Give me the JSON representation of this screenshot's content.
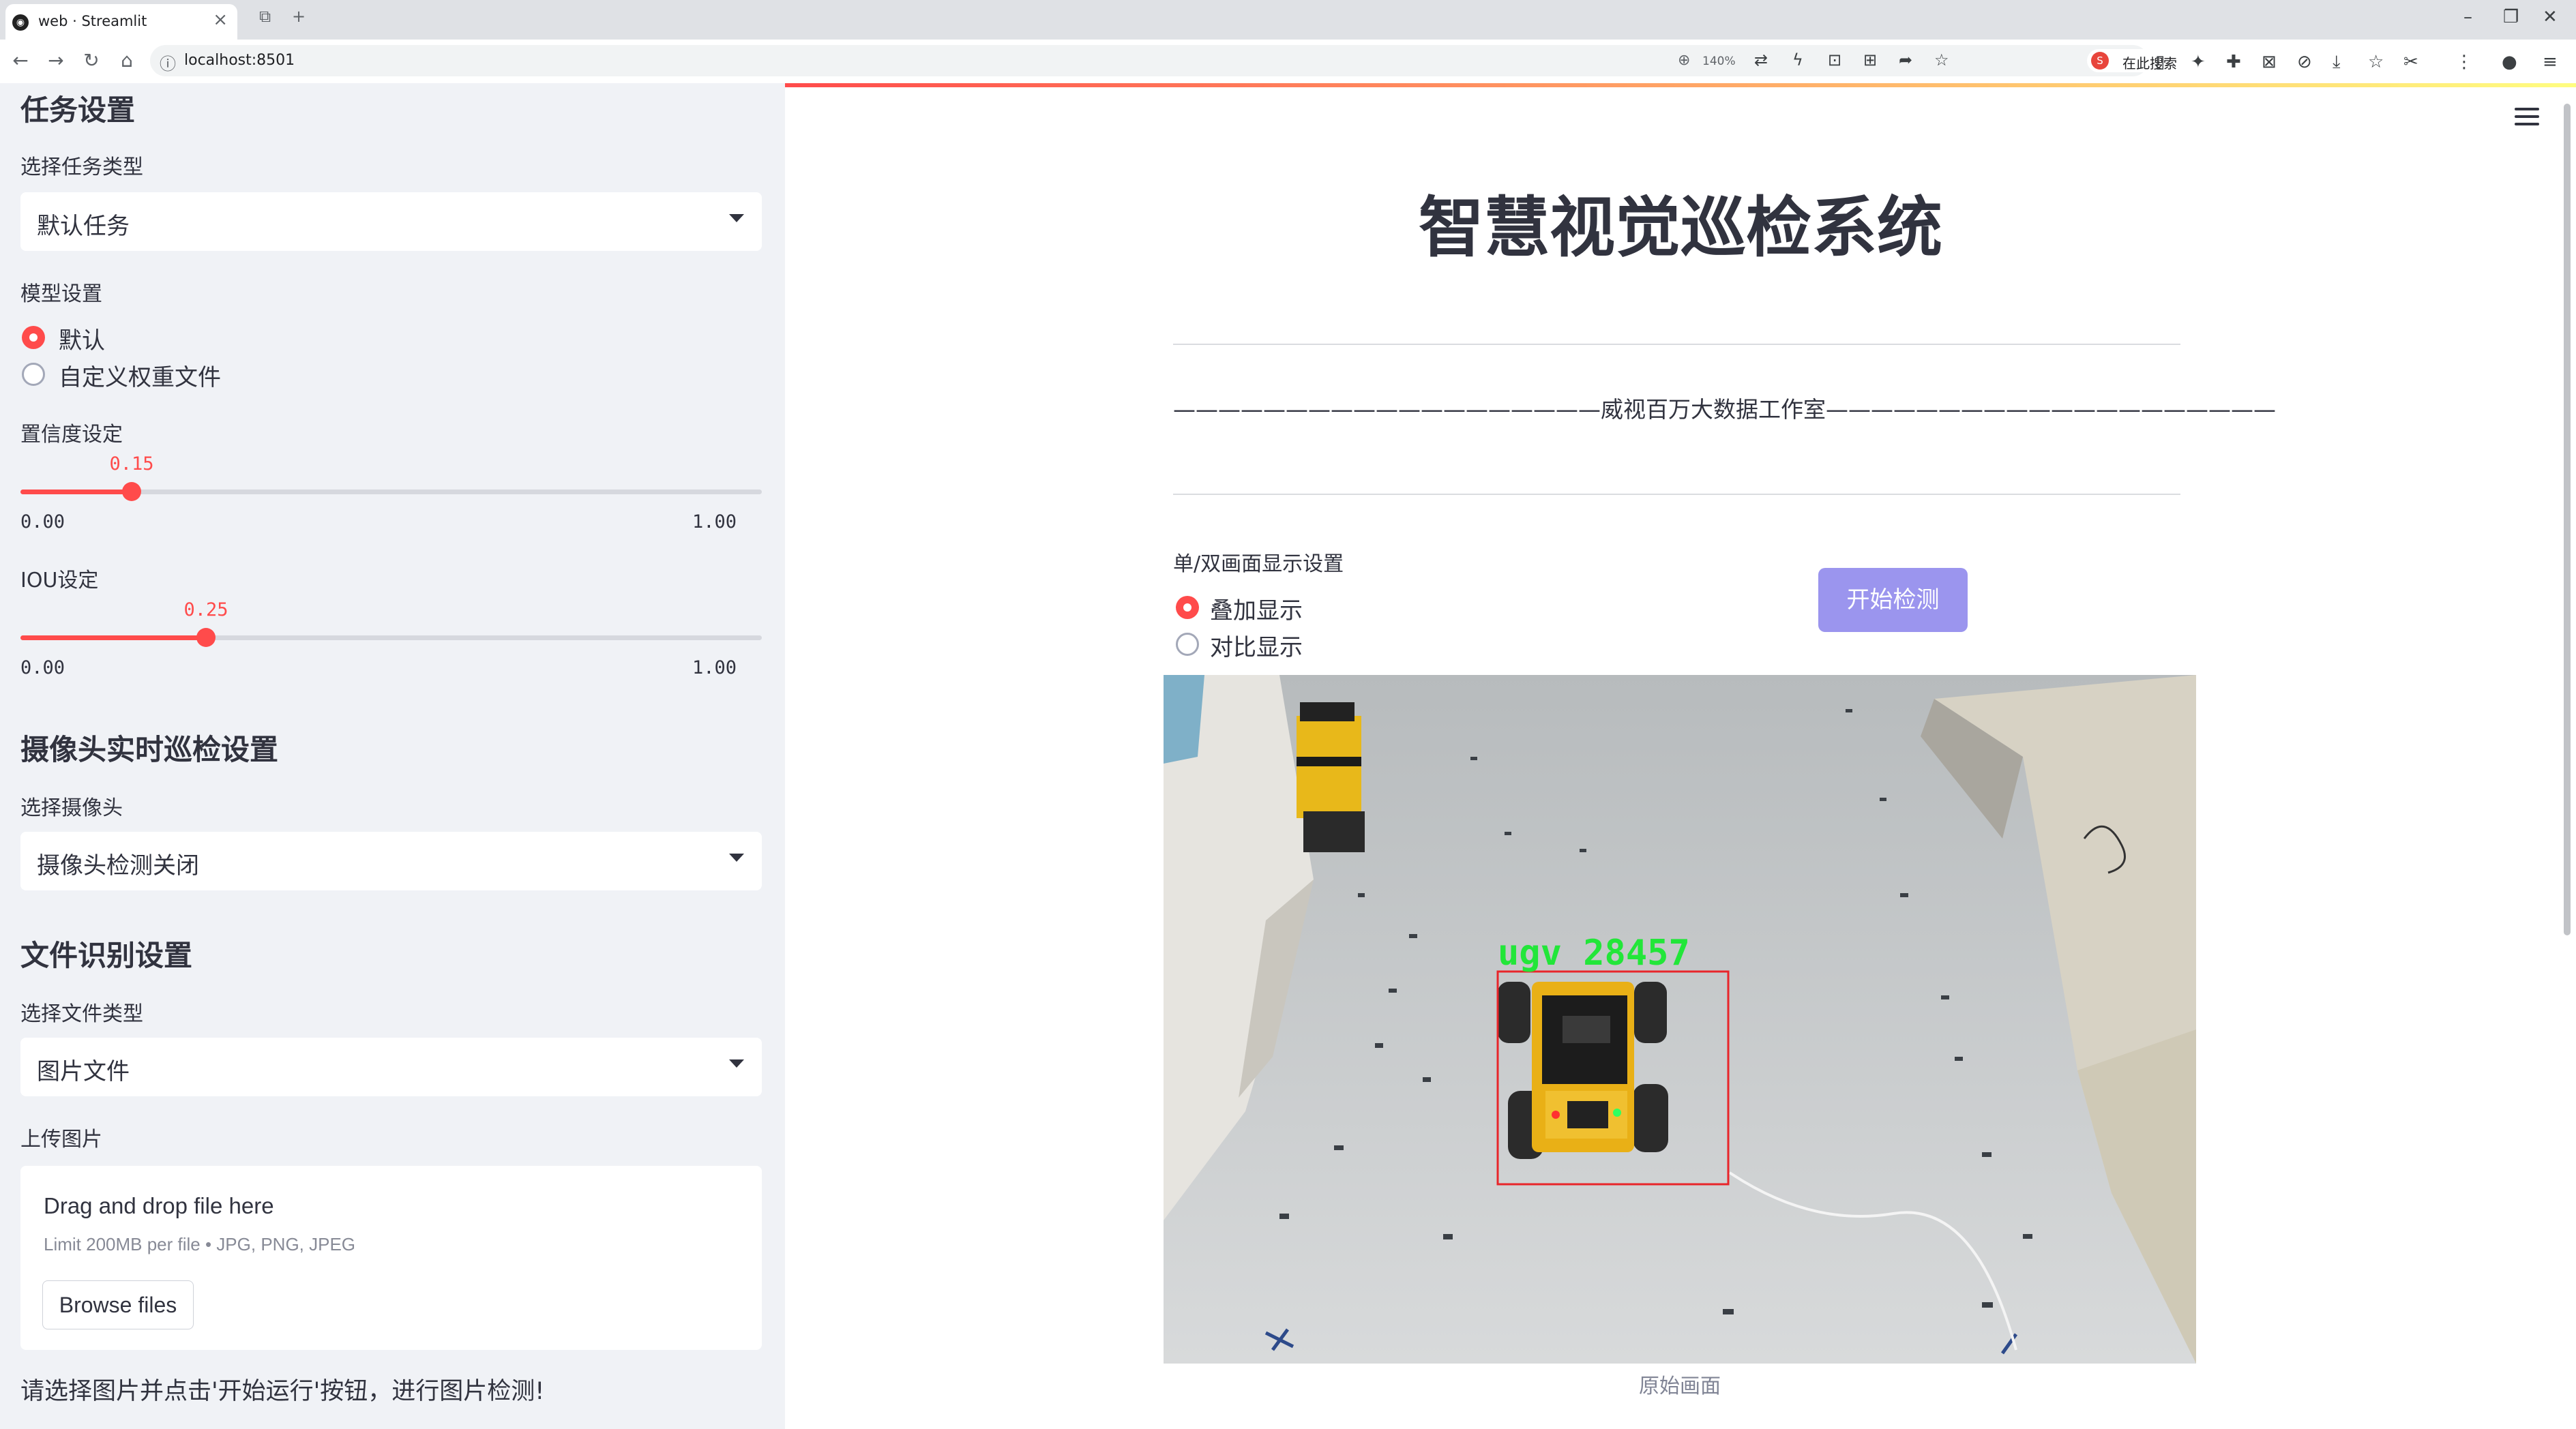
{
  "browser": {
    "tab_title": "web · Streamlit",
    "url": "localhost:8501",
    "zoom": "140%",
    "search_label": "在此搜索"
  },
  "sidebar": {
    "task_header": "任务设置",
    "task_type_label": "选择任务类型",
    "task_type_value": "默认任务",
    "model_label": "模型设置",
    "model_options": [
      "默认",
      "自定义权重文件"
    ],
    "model_selected": "默认",
    "conf_label": "置信度设定",
    "conf": {
      "value": 0.15,
      "value_text": "0.15",
      "min": "0.00",
      "max": "1.00"
    },
    "iou_label": "IOU设定",
    "iou": {
      "value": 0.25,
      "value_text": "0.25",
      "min": "0.00",
      "max": "1.00"
    },
    "camera_header": "摄像头实时巡检设置",
    "camera_label": "选择摄像头",
    "camera_value": "摄像头检测关闭",
    "file_header": "文件识别设置",
    "file_type_label": "选择文件类型",
    "file_type_value": "图片文件",
    "upload_label": "上传图片",
    "upload_main": "Drag and drop file here",
    "upload_sub": "Limit 200MB per file • JPG, PNG, JPEG",
    "browse_label": "Browse files",
    "hint": "请选择图片并点击'开始运行'按钮，进行图片检测!"
  },
  "main": {
    "title": "智慧视觉巡检系统",
    "subtitle": "———————————————————威视百万大数据工作室————————————————————",
    "display_label": "单/双画面显示设置",
    "display_options": [
      "叠加显示",
      "对比显示"
    ],
    "display_selected": "叠加显示",
    "start_button": "开始检测",
    "detection_label": "ugv  28457",
    "image_caption": "原始画面"
  },
  "colors": {
    "accent": "#ff4b4b",
    "sidebar_bg": "#f0f2f6",
    "start_button": "#9b95ee",
    "detection_box": "#e8252a",
    "detection_text": "#22e639"
  }
}
